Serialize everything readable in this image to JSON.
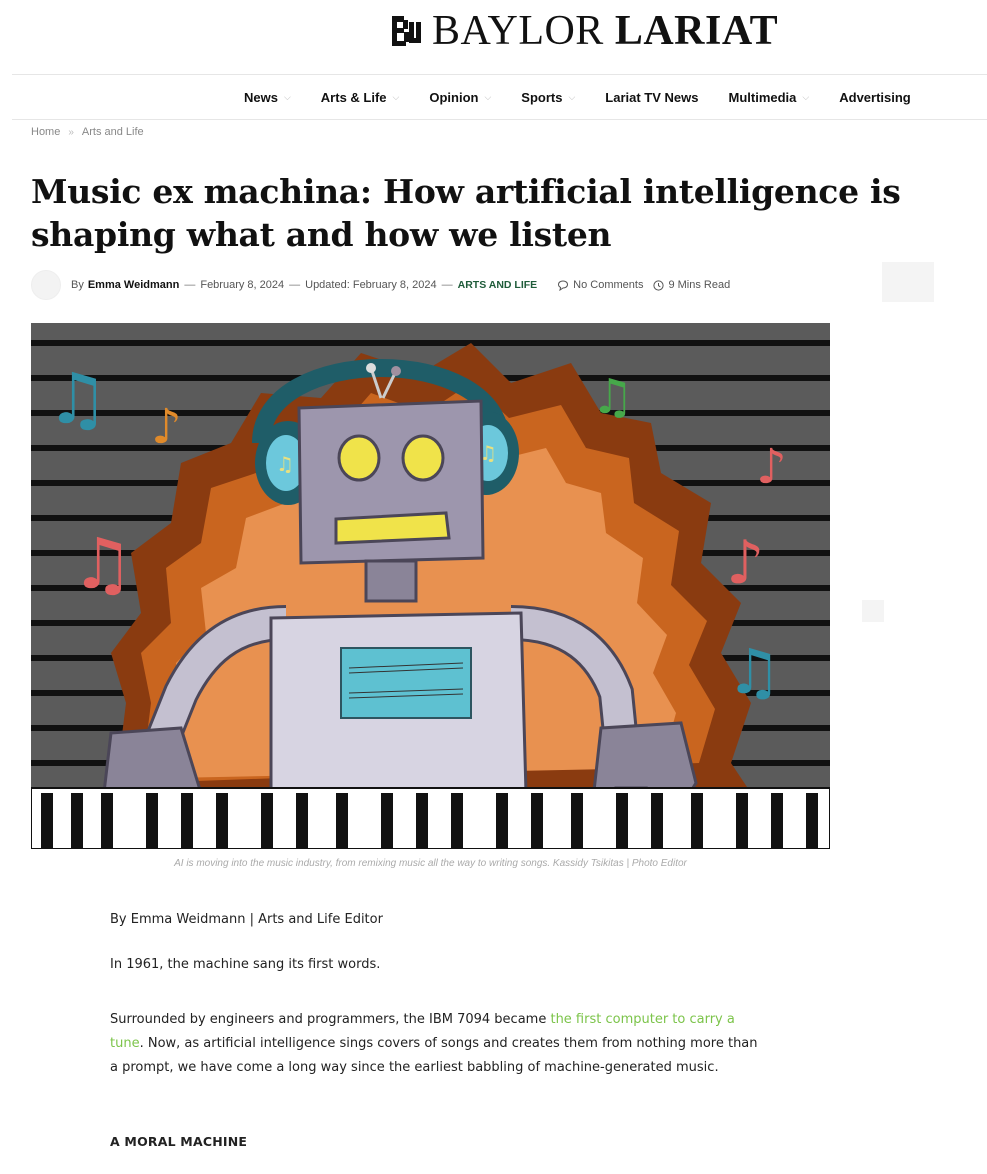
{
  "masthead": {
    "logo_word1": "BAYLOR",
    "logo_word2": "LARIAT",
    "logo_mark": "bu-monogram-icon"
  },
  "nav": {
    "items": [
      {
        "label": "News",
        "has_dropdown": true
      },
      {
        "label": "Arts & Life",
        "has_dropdown": true
      },
      {
        "label": "Opinion",
        "has_dropdown": true
      },
      {
        "label": "Sports",
        "has_dropdown": true
      },
      {
        "label": "Lariat TV News",
        "has_dropdown": false
      },
      {
        "label": "Multimedia",
        "has_dropdown": true
      },
      {
        "label": "Advertising",
        "has_dropdown": false
      }
    ]
  },
  "breadcrumb": {
    "home": "Home",
    "separator": "»",
    "current": "Arts and Life"
  },
  "article": {
    "title": "Music ex machina: How artificial intelligence is shaping what and how we listen",
    "meta": {
      "by": "By",
      "author": "Emma Weidmann",
      "dash": "—",
      "published": "February 8, 2024",
      "updated_label": "Updated:",
      "updated": "February 8, 2024",
      "category": "ARTS AND LIFE",
      "comments": "No Comments",
      "read_time": "9 Mins Read"
    },
    "image_caption": "AI is moving into the music industry, from remixing music all the way to writing songs. Kassidy Tsikitas | Photo Editor",
    "byline": "By Emma Weidmann | Arts and Life Editor",
    "paragraph1": "In 1961, the machine sang its first words.",
    "paragraph2_before": "Surrounded by engineers and programmers, the IBM 7094 became ",
    "paragraph2_link": "the first computer to carry a tune",
    "paragraph2_after": ". Now, as artificial intelligence sings covers of songs and creates them from nothing more than a prompt, we have come a long way since the earliest babbling of machine-generated music.",
    "section_heading": "A MORAL MACHINE"
  },
  "colors": {
    "link_green": "#7cc44a",
    "category_green": "#1f5c3a"
  }
}
